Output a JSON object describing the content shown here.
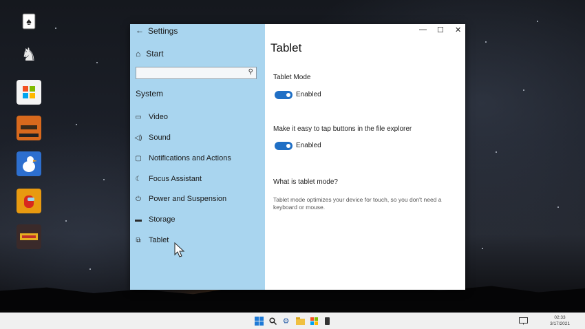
{
  "window": {
    "title": "Settings",
    "controls": {
      "minimize": "—",
      "maximize": "☐",
      "close": "✕"
    }
  },
  "sidebar": {
    "start_label": "Start",
    "search": {
      "placeholder": ""
    },
    "section_label": "System",
    "items": [
      {
        "label": "Video",
        "icon": "monitor-icon"
      },
      {
        "label": "Sound",
        "icon": "speaker-icon"
      },
      {
        "label": "Notifications and Actions",
        "icon": "notification-icon"
      },
      {
        "label": "Focus Assistant",
        "icon": "moon-icon"
      },
      {
        "label": "Power and Suspension",
        "icon": "power-icon"
      },
      {
        "label": "Storage",
        "icon": "storage-icon"
      },
      {
        "label": "Tablet",
        "icon": "tablet-icon"
      }
    ]
  },
  "content": {
    "title": "Tablet",
    "tablet_mode_label": "Tablet Mode",
    "tablet_mode_state": "Enabled",
    "explorer_label": "Make it easy to tap buttons in the file explorer",
    "explorer_state": "Enabled",
    "help_heading": "What is tablet mode?",
    "help_text": "Tablet mode optimizes your device for touch, so you don't need a keyboard or mouse."
  },
  "desktop_icons": [
    "solitaire-icon",
    "chess-icon",
    "store-icon",
    "venge-icon",
    "goose-icon",
    "among-us-icon",
    "giants-icon"
  ],
  "taskbar": {
    "icons": [
      "windows-start-icon",
      "search-icon",
      "settings-gear-icon",
      "file-explorer-icon",
      "store-icon",
      "phone-icon"
    ],
    "clock_time": "02:33",
    "clock_date": "3/17/2021"
  },
  "colors": {
    "sidebar_bg": "#a9d5ef",
    "toggle_on": "#1f6fc5"
  }
}
